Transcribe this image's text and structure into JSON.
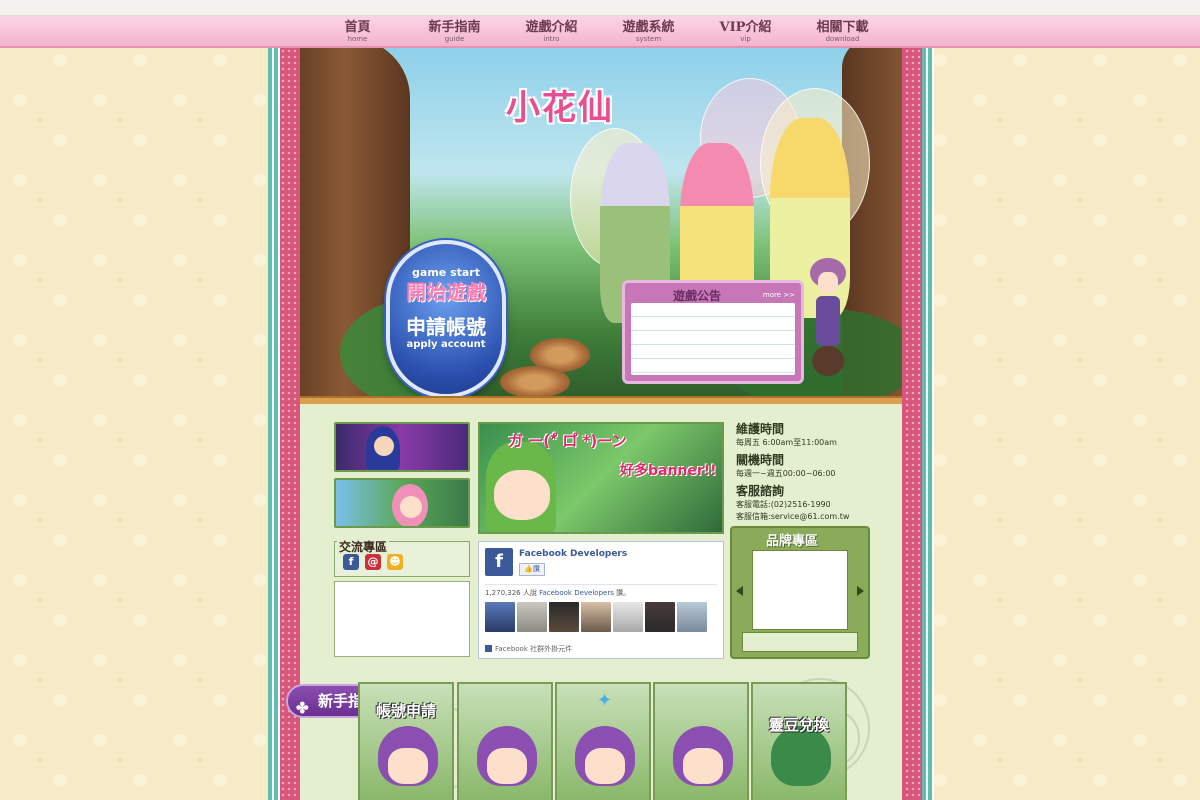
{
  "nav": [
    {
      "zh": "首頁",
      "en": "home"
    },
    {
      "zh": "新手指南",
      "en": "guide"
    },
    {
      "zh": "遊戲介紹",
      "en": "intro"
    },
    {
      "zh": "遊戲系統",
      "en": "system"
    },
    {
      "zh": "VIP介紹",
      "en": "vip"
    },
    {
      "zh": "相關下載",
      "en": "download"
    }
  ],
  "banner": {
    "logo": "小花仙",
    "start_en": "game start",
    "start_zh": "開始遊戲",
    "apply_zh": "申請帳號",
    "apply_en": "apply account"
  },
  "notice": {
    "title": "遊戲公告",
    "more": "more >>"
  },
  "promo": {
    "line1": "ガ ー(*゚ ロ゚ *)ーン",
    "line2": "好多banner!!"
  },
  "info": {
    "maint_h": "維護時間",
    "maint_t": "每周五 6:00am至11:00am",
    "off_h": "關機時間",
    "off_t": "每週一~週五00:00~06:00",
    "cs_h": "客服諮詢",
    "cs_phone": "客服電話:(02)2516-1990",
    "cs_mail": "客服信箱:service@61.com.tw"
  },
  "exchange": {
    "title": "交流專區"
  },
  "facebook": {
    "page": "Facebook Developers",
    "like": "讚",
    "count_pre": "1,270,326 人說 ",
    "count_name": "Facebook Developers",
    "count_post": " 讚。",
    "footer": "Facebook 社群外掛元件"
  },
  "brand": {
    "title": "品牌專區"
  },
  "guide": {
    "tag": "新手指南",
    "cards": [
      {
        "label": "帳號申請"
      },
      {
        "label": ""
      },
      {
        "label": ""
      },
      {
        "label": ""
      },
      {
        "label": "靈豆兌換"
      }
    ]
  },
  "colors": {
    "accent_pink": "#f3b4cc",
    "frame_pink": "#d7557a",
    "content_green": "#e3efcf",
    "guide_purple": "#6a2f90"
  }
}
